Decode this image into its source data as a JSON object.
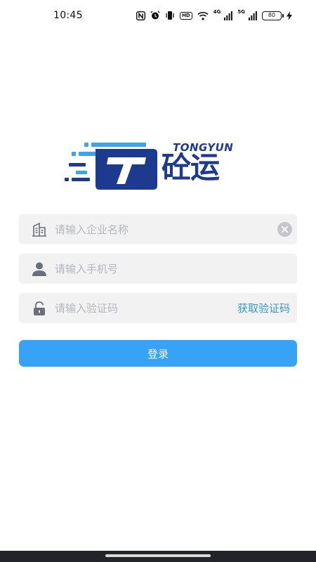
{
  "status_bar": {
    "time": "10:45",
    "hd_label": "HD",
    "network1": "4G",
    "network2": "5G",
    "battery": "80"
  },
  "logo": {
    "latin": "TONGYUN",
    "chinese": "砼运",
    "colors": {
      "dark_blue": "#1d3a8e",
      "light_blue": "#3fa3ec"
    }
  },
  "form": {
    "company": {
      "placeholder": "请输入企业名称",
      "value": "",
      "icon": "building-icon"
    },
    "phone": {
      "placeholder": "请输入手机号",
      "value": "",
      "icon": "user-icon"
    },
    "code": {
      "placeholder": "请输入验证码",
      "value": "",
      "icon": "lock-icon",
      "get_code_label": "获取验证码"
    }
  },
  "login_button": {
    "label": "登录",
    "color": "#36a3f7"
  }
}
